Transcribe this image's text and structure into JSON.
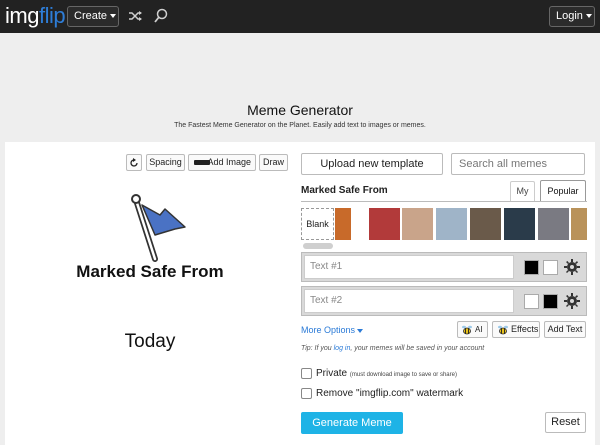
{
  "header": {
    "logo_img": "img",
    "logo_flip": "flip",
    "create_label": "Create",
    "login_label": "Login"
  },
  "page": {
    "title": "Meme Generator",
    "subtitle": "The Fastest Meme Generator on the Planet. Easily add text to images or memes."
  },
  "tools": {
    "spacing_label": "Spacing",
    "add_image_label": "Add Image",
    "draw_label": "Draw"
  },
  "meme": {
    "top_text": "Marked Safe From",
    "bottom_text": "Today",
    "flag_color": "#4a72c4"
  },
  "templates": {
    "upload_label": "Upload new template",
    "search_placeholder": "Search all memes",
    "current_title": "Marked Safe From",
    "tab_my": "My",
    "tab_popular": "Popular",
    "blank_label": "Blank",
    "thumbnails": [
      {
        "name": "thumb-1",
        "color": "#c86a2a"
      },
      {
        "name": "thumb-2",
        "color": "#b23a3a"
      },
      {
        "name": "thumb-3",
        "color": "#c9a48a"
      },
      {
        "name": "thumb-4",
        "color": "#9fb4c8"
      },
      {
        "name": "thumb-5",
        "color": "#6a5a4a"
      },
      {
        "name": "thumb-6",
        "color": "#caa23e"
      },
      {
        "name": "thumb-7",
        "color": "#2a3b4a"
      },
      {
        "name": "thumb-8",
        "color": "#3b4b5a"
      },
      {
        "name": "thumb-9",
        "color": "#7a7a82"
      },
      {
        "name": "thumb-10",
        "color": "#b9925a"
      }
    ]
  },
  "text_boxes": [
    {
      "placeholder": "Text #1",
      "swatch1": "#000000",
      "swatch2": "#ffffff"
    },
    {
      "placeholder": "Text #2",
      "swatch1": "#ffffff",
      "swatch2": "#000000"
    }
  ],
  "options": {
    "more_options_label": "More Options",
    "ai_label": "AI",
    "effects_label": "Effects",
    "add_text_label": "Add Text",
    "tip_prefix": "Tip: If you ",
    "tip_link": "log in",
    "tip_suffix": ", your memes will be saved in your account",
    "private_label": "Private",
    "private_note": "(must download image to save or share)",
    "watermark_label": "Remove \"imgflip.com\" watermark",
    "generate_label": "Generate Meme",
    "reset_label": "Reset"
  }
}
